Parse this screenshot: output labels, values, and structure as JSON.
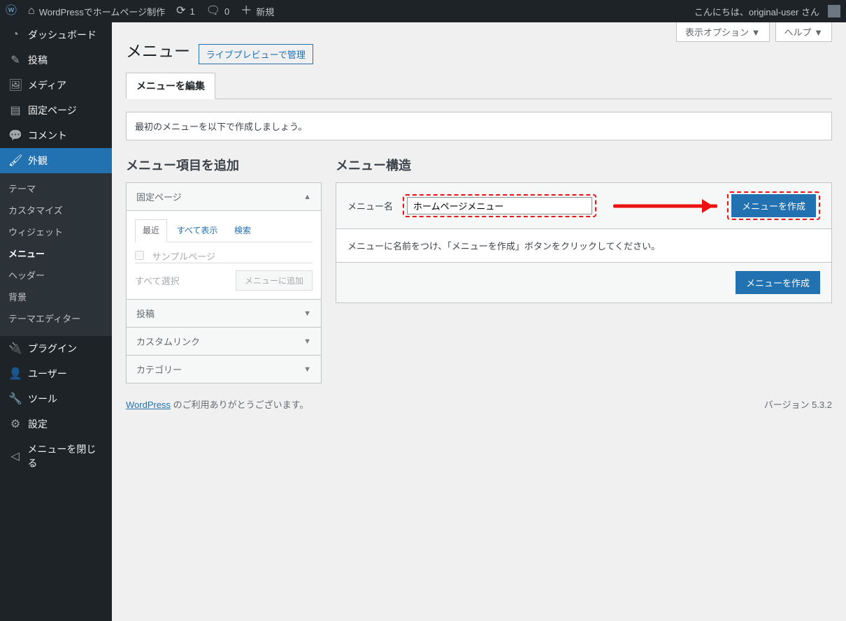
{
  "topbar": {
    "site_name": "WordPressでホームページ制作",
    "updates_count": "1",
    "comments_count": "0",
    "new_label": "新規",
    "greeting": "こんにちは、original-user さん"
  },
  "sidebar": {
    "items": [
      {
        "icon": "🏠",
        "label": "ダッシュボード"
      },
      {
        "icon": "📌",
        "label": "投稿"
      },
      {
        "icon": "🖼",
        "label": "メディア"
      },
      {
        "icon": "📄",
        "label": "固定ページ"
      },
      {
        "icon": "💬",
        "label": "コメント"
      },
      {
        "icon": "🖌",
        "label": "外観"
      },
      {
        "icon": "🔌",
        "label": "プラグイン"
      },
      {
        "icon": "👤",
        "label": "ユーザー"
      },
      {
        "icon": "🔧",
        "label": "ツール"
      },
      {
        "icon": "⚙",
        "label": "設定"
      },
      {
        "icon": "◀",
        "label": "メニューを閉じる"
      }
    ],
    "appearance_sub": [
      "テーマ",
      "カスタマイズ",
      "ウィジェット",
      "メニュー",
      "ヘッダー",
      "背景",
      "テーマエディター"
    ]
  },
  "screen_meta": {
    "options": "表示オプション ▼",
    "help": "ヘルプ ▼"
  },
  "heading": {
    "title": "メニュー",
    "preview_btn": "ライブプレビューで管理"
  },
  "tabs": {
    "edit": "メニューを編集"
  },
  "notice": "最初のメニューを以下で作成しましょう。",
  "left": {
    "heading": "メニュー項目を追加",
    "acc": [
      "固定ページ",
      "投稿",
      "カスタムリンク",
      "カテゴリー"
    ],
    "subtabs": {
      "recent": "最近",
      "all": "すべて表示",
      "search": "検索"
    },
    "sample_page": "サンプルページ",
    "select_all": "すべて選択",
    "add_btn": "メニューに追加"
  },
  "right": {
    "heading": "メニュー構造",
    "name_label": "メニュー名",
    "name_value": "ホームページメニュー",
    "create_btn": "メニューを作成",
    "instruction": "メニューに名前をつけ、「メニューを作成」ボタンをクリックしてください。"
  },
  "footer": {
    "thanks_pre": "WordPress",
    "thanks_post": " のご利用ありがとうございます。",
    "version": "バージョン 5.3.2"
  }
}
